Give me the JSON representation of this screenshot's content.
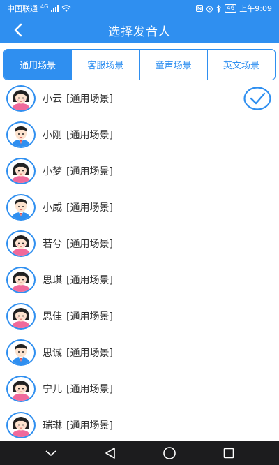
{
  "status": {
    "carrier": "中国联通",
    "network": "4G",
    "battery": "46",
    "time": "上午9:09"
  },
  "header": {
    "title": "选择发音人"
  },
  "tabs": [
    {
      "label": "通用场景",
      "active": true
    },
    {
      "label": "客服场景",
      "active": false
    },
    {
      "label": "童声场景",
      "active": false
    },
    {
      "label": "英文场景",
      "active": false
    }
  ],
  "voices": [
    {
      "name": "小云",
      "tag": "[通用场景]",
      "gender": "female",
      "selected": true
    },
    {
      "name": "小刚",
      "tag": "[通用场景]",
      "gender": "male",
      "selected": false
    },
    {
      "name": "小梦",
      "tag": "[通用场景]",
      "gender": "female",
      "selected": false
    },
    {
      "name": "小威",
      "tag": "[通用场景]",
      "gender": "male",
      "selected": false
    },
    {
      "name": "若兮",
      "tag": "[通用场景]",
      "gender": "female",
      "selected": false
    },
    {
      "name": "思琪",
      "tag": "[通用场景]",
      "gender": "female",
      "selected": false
    },
    {
      "name": "思佳",
      "tag": "[通用场景]",
      "gender": "female",
      "selected": false
    },
    {
      "name": "思诚",
      "tag": "[通用场景]",
      "gender": "male",
      "selected": false
    },
    {
      "name": "宁儿",
      "tag": "[通用场景]",
      "gender": "female",
      "selected": false
    },
    {
      "name": "瑞琳",
      "tag": "[通用场景]",
      "gender": "female",
      "selected": false
    }
  ],
  "colors": {
    "primary": "#2f8ff0",
    "nav": "#1c1c1e",
    "text": "#333333"
  },
  "icons": {
    "back": "chevron-left-icon",
    "selected": "checkmark-circle-icon",
    "nav": [
      "nav-down-icon",
      "nav-back-icon",
      "nav-home-icon",
      "nav-recent-icon"
    ]
  }
}
